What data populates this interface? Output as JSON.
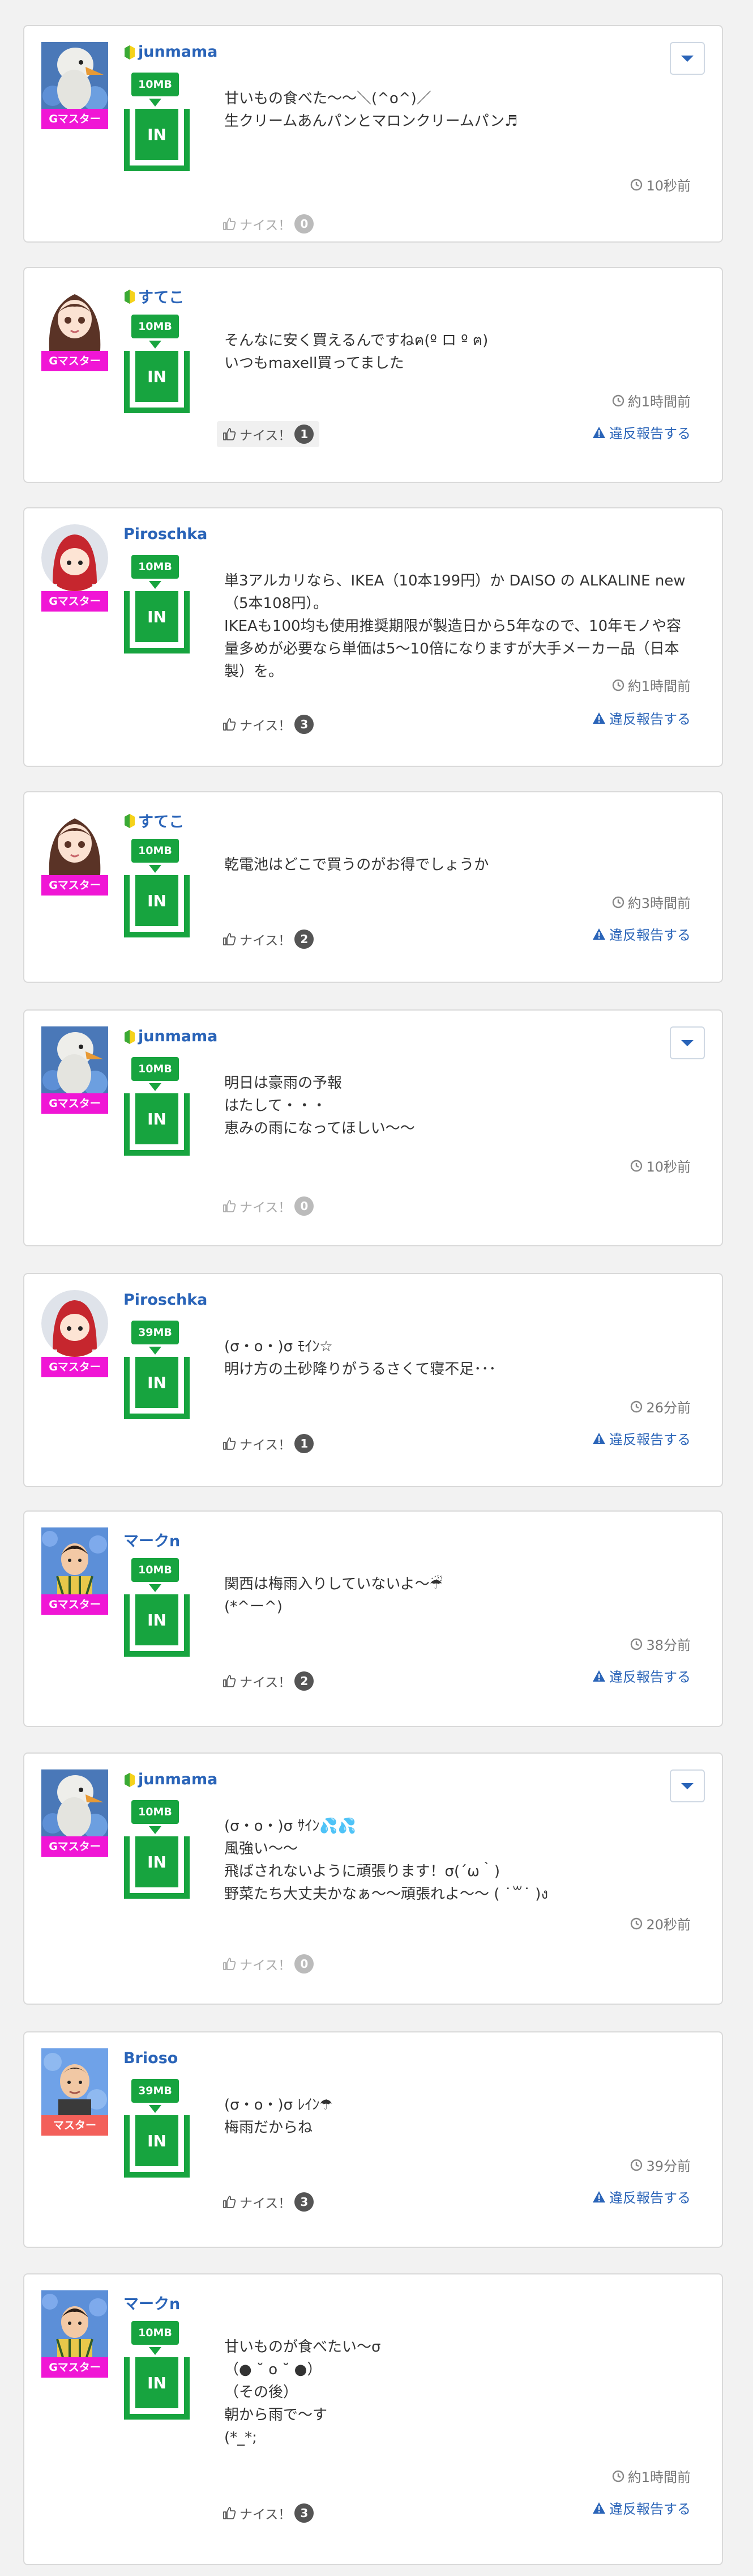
{
  "labels": {
    "nice": "ナイス！",
    "report": "違反報告する",
    "in": "IN"
  },
  "colors": {
    "rank_g": "#f016d5",
    "rank_master": "#f3605a",
    "storage": "#17a43f",
    "link": "#2a64b8"
  },
  "posts": [
    {
      "user": "junmama",
      "beginner": true,
      "avatar": "swan-avatar",
      "rank": "Gマスター",
      "storage": "10MB",
      "lines": [
        "甘いもの食べた〜〜＼(^o^)／",
        "生クリームあんパンとマロンクリームパン♬"
      ],
      "time": "10秒前",
      "nice_count": "0",
      "report": false,
      "dropdown": true
    },
    {
      "user": "すてこ",
      "beginner": true,
      "avatar": "girl-avatar",
      "rank": "Gマスター",
      "storage": "10MB",
      "lines": [
        "そんなに安く買えるんですねฅ(º ロ º ฅ)",
        "いつもmaxell買ってました"
      ],
      "time": "約1時間前",
      "nice_count": "1",
      "report": true,
      "dropdown": false
    },
    {
      "user": "Piroschka",
      "beginner": false,
      "avatar": "red-hood-avatar",
      "rank": "Gマスター",
      "storage": "10MB",
      "lines": [
        "単3アルカリなら、IKEA（10本199円）か DAISO の ALKALINE new（5本108円）。",
        "IKEAも100均も使用推奨期限が製造日から5年なので、10年モノや容量多めが必要なら単価は5〜10倍になりますが大手メーカー品（日本製）を。"
      ],
      "time": "約1時間前",
      "nice_count": "3",
      "report": true,
      "dropdown": false
    },
    {
      "user": "すてこ",
      "beginner": true,
      "avatar": "girl-avatar",
      "rank": "Gマスター",
      "storage": "10MB",
      "lines": [
        "乾電池はどこで買うのがお得でしょうか"
      ],
      "time": "約3時間前",
      "nice_count": "2",
      "report": true,
      "dropdown": false
    },
    {
      "user": "junmama",
      "beginner": true,
      "avatar": "swan-avatar",
      "rank": "Gマスター",
      "storage": "10MB",
      "lines": [
        "明日は豪雨の予報",
        "はたして・・・",
        "恵みの雨になってほしい〜〜"
      ],
      "time": "10秒前",
      "nice_count": "0",
      "report": false,
      "dropdown": true
    },
    {
      "user": "Piroschka",
      "beginner": false,
      "avatar": "red-hood-avatar",
      "rank": "Gマスター",
      "storage": "39MB",
      "lines": [
        "(σ・o・)σ ﾓｲﾝ☆",
        "明け方の土砂降りがうるさくて寝不足･･･"
      ],
      "time": "26分前",
      "nice_count": "1",
      "report": true,
      "dropdown": false
    },
    {
      "user": "マークn",
      "beginner": false,
      "avatar": "boy-avatar",
      "rank": "Gマスター",
      "storage": "10MB",
      "lines": [
        "関西は梅雨入りしていないよ〜☔",
        "(*^ー^)"
      ],
      "time": "38分前",
      "nice_count": "2",
      "report": true,
      "dropdown": false
    },
    {
      "user": "junmama",
      "beginner": true,
      "avatar": "swan-avatar",
      "rank": "Gマスター",
      "storage": "10MB",
      "lines": [
        "(σ・o・)σ ｻｲﾝ💦💦",
        "風強い〜〜",
        "飛ばされないように頑張ります！σ(´ω｀)",
        "野菜たち大丈夫かなぁ〜〜頑張れよ〜〜 ( ˙꒳​˙ )ง"
      ],
      "time": "20秒前",
      "nice_count": "0",
      "report": false,
      "dropdown": true
    },
    {
      "user": "Brioso",
      "beginner": false,
      "avatar": "man-avatar",
      "rank": "マスター",
      "storage": "39MB",
      "lines": [
        "(σ・o・)σ ﾚｲﾝ☂",
        "梅雨だからね"
      ],
      "time": "39分前",
      "nice_count": "3",
      "report": true,
      "dropdown": false
    },
    {
      "user": "マークn",
      "beginner": false,
      "avatar": "boy-avatar",
      "rank": "Gマスター",
      "storage": "10MB",
      "lines": [
        "甘いものが食べたい〜σ",
        "（● ˘ o ˘ ●）",
        "（その後）",
        "朝から雨で〜す",
        "(*_*;"
      ],
      "time": "約1時間前",
      "nice_count": "3",
      "report": true,
      "dropdown": false
    }
  ]
}
